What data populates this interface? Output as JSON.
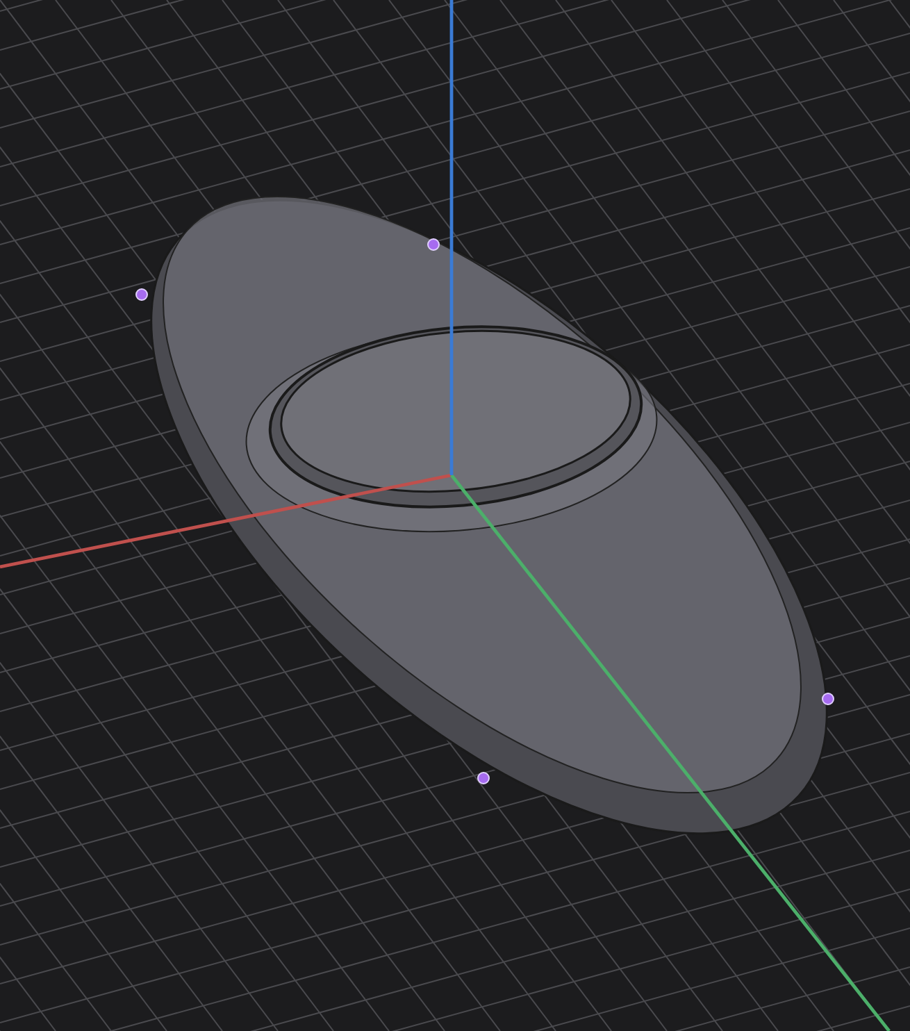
{
  "viewport": {
    "axes": [
      {
        "kind": "x",
        "color": "#c0504d"
      },
      {
        "kind": "y",
        "color": "#4caf6a"
      },
      {
        "kind": "z",
        "color": "#3a7bd5"
      }
    ]
  }
}
